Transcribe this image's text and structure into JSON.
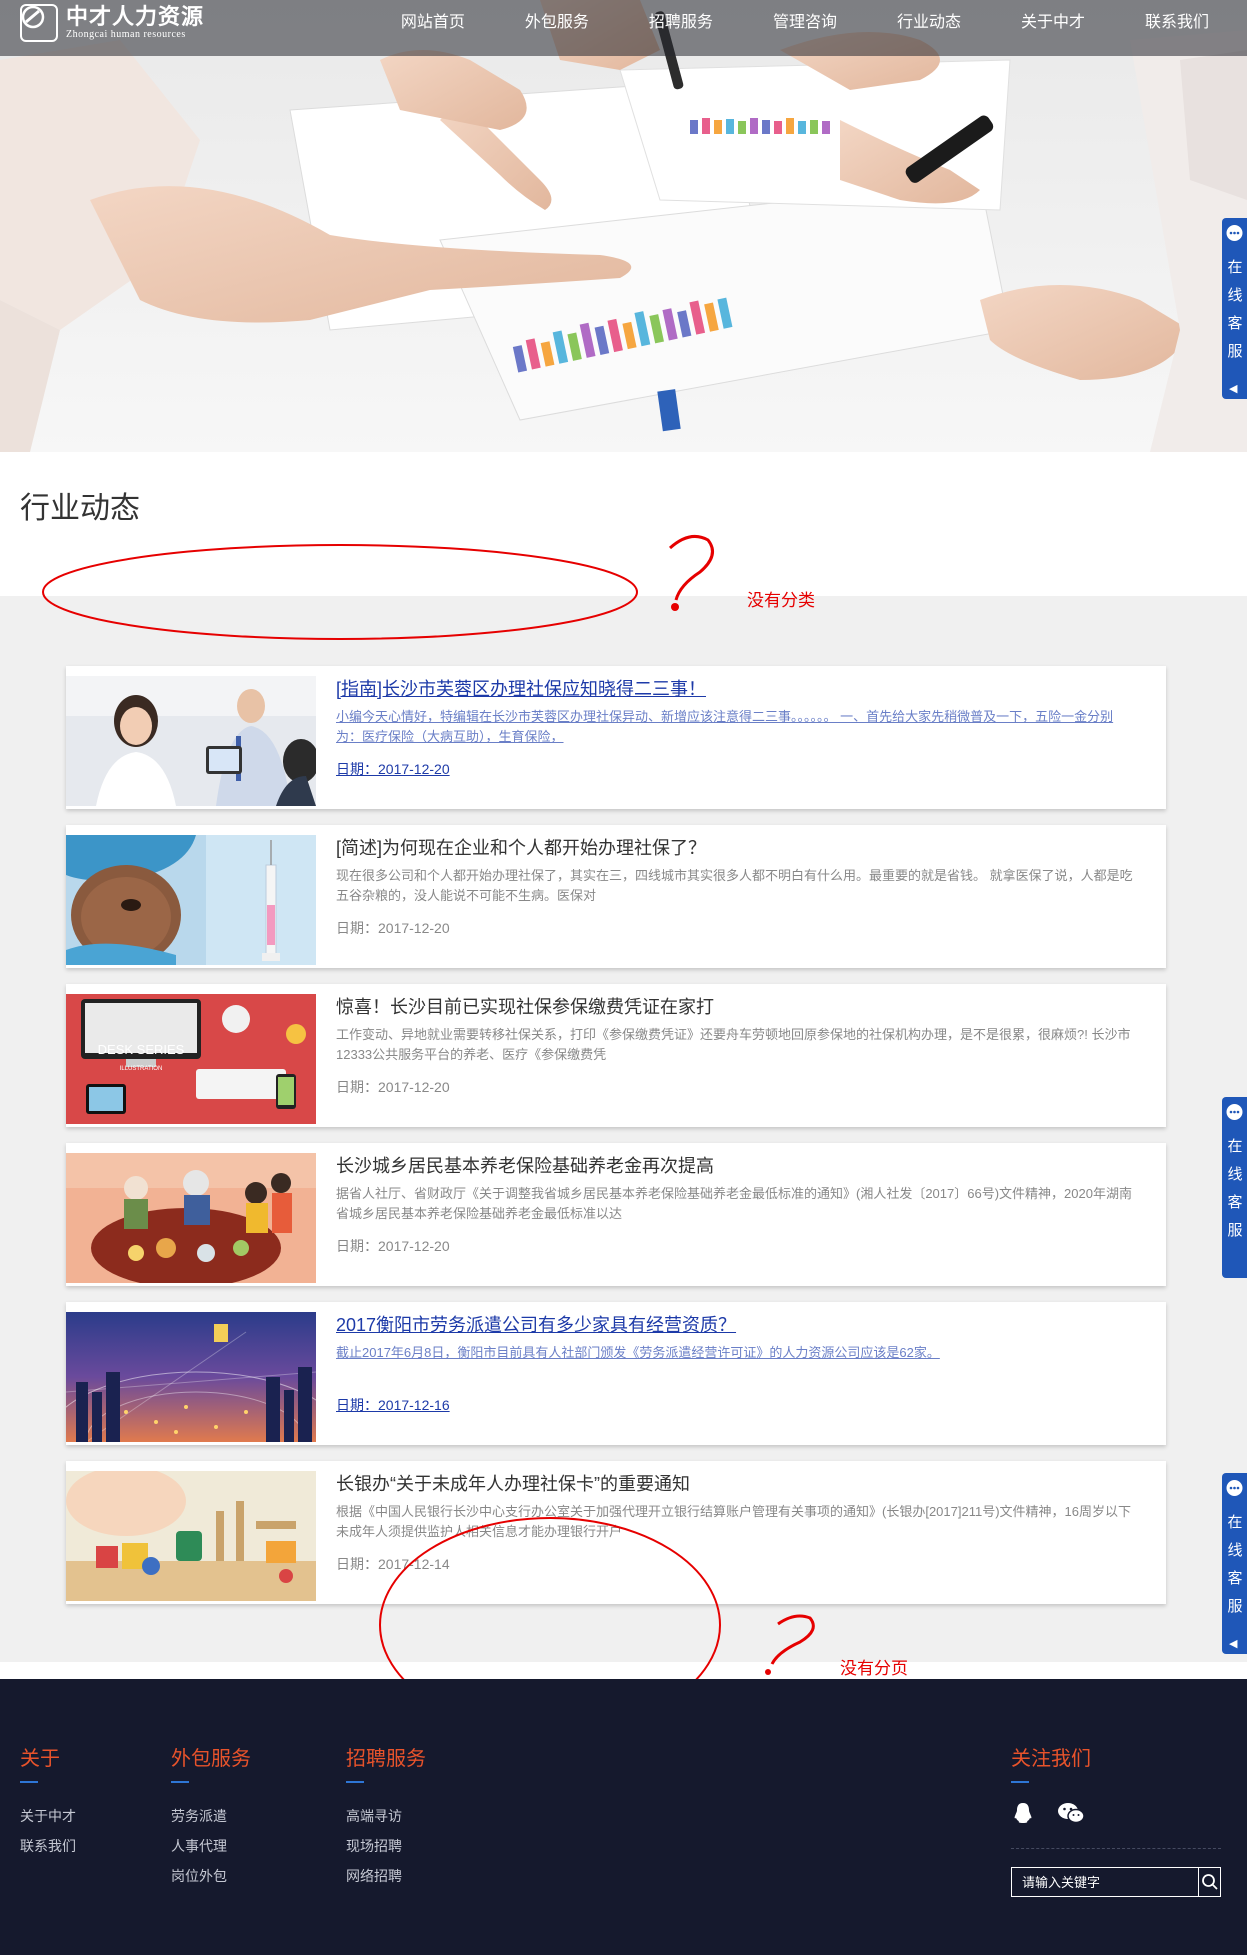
{
  "header": {
    "logo_cn": "中才人力资源",
    "logo_en": "Zhongcai human resources",
    "nav": [
      {
        "label": "网站首页"
      },
      {
        "label": "外包服务"
      },
      {
        "label": "招聘服务"
      },
      {
        "label": "管理咨询"
      },
      {
        "label": "行业动态"
      },
      {
        "label": "关于中才"
      },
      {
        "label": "联系我们"
      }
    ]
  },
  "page": {
    "title": "行业动态",
    "annotation_no_category": "没有分类",
    "annotation_no_pagination": "没有分页"
  },
  "articles": [
    {
      "title": "[指南]长沙市芙蓉区办理社保应知晓得二三事！",
      "desc": "小编今天心情好，特编辑在长沙市芙蓉区办理社保异动、新增应该注意得二三事。。。。。。 一、首先给大家先稍微普及一下，五险一金分别为：医疗保险（大病互助），生育保险，",
      "date": "日期：2017-12-20",
      "thumb": "office-team-photo"
    },
    {
      "title": "[简述]为何现在企业和个人都开始办理社保了？",
      "desc": "现在很多公司和个人都开始办理社保了，其实在三，四线城市其实很多人都不明白有什么用。最重要的就是省钱。 就拿医保了说，人都是吃五谷杂粮的，没人能说不可能不生病。医保对",
      "date": "日期：2017-12-20",
      "thumb": "nurse-syringe-photo"
    },
    {
      "title": "惊喜！长沙目前已实现社保参保缴费凭证在家打",
      "desc": "工作变动、异地就业需要转移社保关系，打印《参保缴费凭证》还要舟车劳顿地回原参保地的社保机构办理，是不是很累，很麻烦?! 长沙市12333公共服务平台的养老、医疗《参保缴费凭",
      "date": "日期：2017-12-20",
      "thumb": "desk-series-illustration",
      "thumb_text_1": "DESK SERIES",
      "thumb_text_2": "ILLUSTRATION"
    },
    {
      "title": "长沙城乡居民基本养老保险基础养老金再次提高",
      "desc": "据省人社厅、省财政厅《关于调整我省城乡居民基本养老保险基础养老金最低标准的通知》(湘人社发〔2017〕66号)文件精神，2020年湖南省城乡居民基本养老保险基础养老金最低标准以达",
      "date": "日期：2017-12-20",
      "thumb": "family-dinner-illustration"
    },
    {
      "title": "2017衡阳市劳务派遣公司有多少家具有经营资质？",
      "desc": "截止2017年6月8日，衡阳市目前具有人社部门颁发《劳务派遣经营许可证》的人力资源公司应该是62家。",
      "date": "日期：2017-12-16",
      "thumb": "city-network-photo"
    },
    {
      "title": "长银办“关于未成年人办理社保卡”的重要通知",
      "desc": "根据《中国人民银行长沙中心支行办公室关于加强代理开立银行结算账户管理有关事项的通知》(长银办[2017]211号)文件精神，16周岁以下未成年人须提供监护人相关信息才能办理银行开户",
      "date": "日期：2017-12-14",
      "thumb": "baby-toys-photo"
    }
  ],
  "footer": {
    "columns": [
      {
        "heading": "关于",
        "links": [
          "关于中才",
          "联系我们"
        ]
      },
      {
        "heading": "外包服务",
        "links": [
          "劳务派遣",
          "人事代理",
          "岗位外包"
        ]
      },
      {
        "heading": "招聘服务",
        "links": [
          "高端寻访",
          "现场招聘",
          "网络招聘"
        ]
      }
    ],
    "follow_heading": "关注我们",
    "search_placeholder": "请输入关键字"
  },
  "service_tab": {
    "chars": [
      "在",
      "线",
      "客",
      "服"
    ],
    "arrow": "◀"
  },
  "colors": {
    "nav_bg": "#3a3d48",
    "accent_blue": "#1f57b8",
    "footer_bg": "#15192d",
    "footer_heading": "#e8532b",
    "annotation_red": "#e60000",
    "highlight_link": "#1d3aa8"
  }
}
